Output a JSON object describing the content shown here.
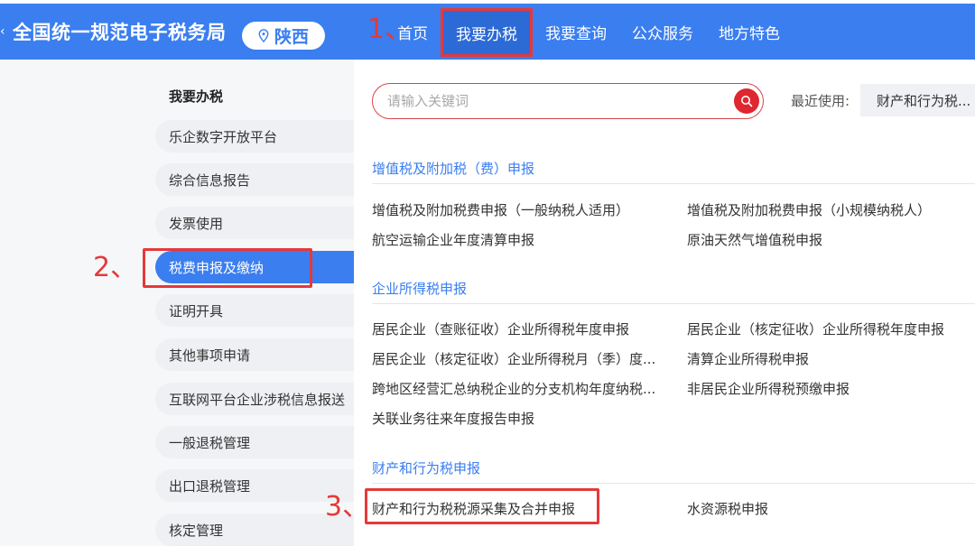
{
  "header": {
    "brand": "全国统一规范电子税务局",
    "region": "陕西",
    "nav": [
      "首页",
      "我要办税",
      "我要查询",
      "公众服务",
      "地方特色"
    ]
  },
  "annotations": {
    "step1": "1、",
    "step2": "2、",
    "step3": "3、"
  },
  "sidebar": {
    "title": "我要办税",
    "items": [
      "乐企数字开放平台",
      "综合信息报告",
      "发票使用",
      "税费申报及缴纳",
      "证明开具",
      "其他事项申请",
      "互联网平台企业涉税信息报送",
      "一般退税管理",
      "出口退税管理",
      "核定管理"
    ],
    "active_index": 3
  },
  "search": {
    "placeholder": "请输入关键词",
    "recent_label": "最近使用:",
    "recent_tag": "财产和行为税..."
  },
  "sections": [
    {
      "title": "增值税及附加税（费）申报",
      "links": [
        "增值税及附加税费申报（一般纳税人适用）",
        "增值税及附加税费申报（小规模纳税人）",
        "航空运输企业年度清算申报",
        "原油天然气增值税申报"
      ]
    },
    {
      "title": "企业所得税申报",
      "links": [
        "居民企业（查账征收）企业所得税年度申报",
        "居民企业（核定征收）企业所得税年度申报",
        "居民企业（核定征收）企业所得税月（季）度...",
        "清算企业所得税申报",
        "跨地区经营汇总纳税企业的分支机构年度纳税...",
        "非居民企业所得税预缴申报",
        "关联业务往来年度报告申报"
      ]
    },
    {
      "title": "财产和行为税申报",
      "links": [
        "财产和行为税税源采集及合并申报",
        "水资源税申报"
      ]
    }
  ],
  "colors": {
    "primary": "#3a7ef0",
    "annotation_red": "#e5393a",
    "search_red": "#e0262e"
  }
}
